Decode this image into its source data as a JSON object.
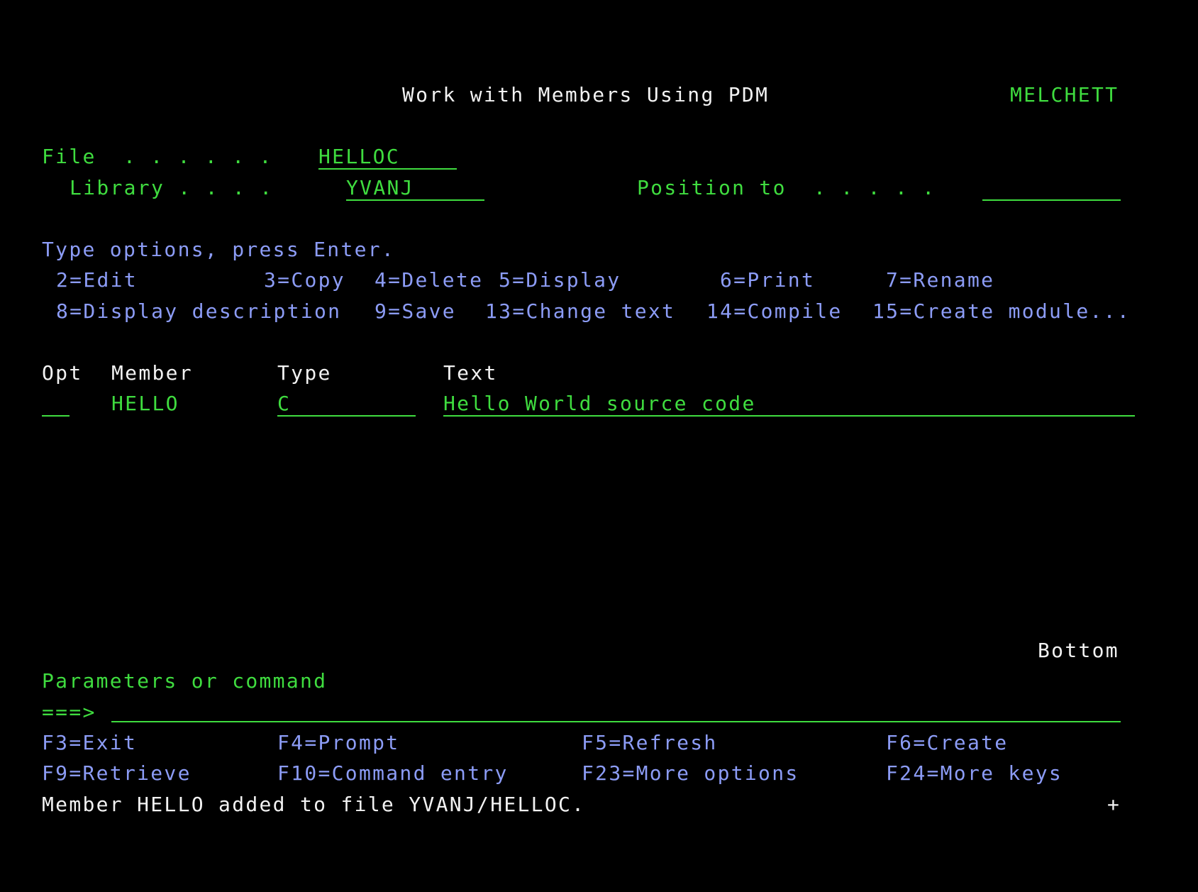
{
  "header": {
    "title": "Work with Members Using PDM",
    "system_name": "MELCHETT"
  },
  "selection": {
    "file_label": "File  . . . . . .",
    "file_value": "HELLOC",
    "library_label": "Library . . . .",
    "library_value": "YVANJ",
    "position_label": "Position to  . . . . .",
    "position_value": ""
  },
  "instructions": {
    "prompt": "Type options, press Enter.",
    "options_row1": [
      "2=Edit",
      "3=Copy",
      "4=Delete",
      "5=Display",
      "6=Print",
      "7=Rename"
    ],
    "options_row2": [
      "8=Display description",
      "9=Save",
      "13=Change text",
      "14=Compile",
      "15=Create module..."
    ]
  },
  "table": {
    "columns": [
      "Opt",
      "Member",
      "Type",
      "Text"
    ],
    "rows": [
      {
        "opt": "",
        "member": "HELLO",
        "type": "C",
        "text": "Hello World source code"
      }
    ],
    "more_indicator": "Bottom"
  },
  "command": {
    "label": "Parameters or command",
    "prompt": "===>",
    "value": ""
  },
  "function_keys": {
    "row1": [
      "F3=Exit",
      "F4=Prompt",
      "F5=Refresh",
      "F6=Create"
    ],
    "row2": [
      "F9=Retrieve",
      "F10=Command entry",
      "F23=More options",
      "F24=More keys"
    ]
  },
  "message": {
    "text": "Member HELLO added to file YVANJ/HELLOC.",
    "more_marker": "+"
  },
  "colors": {
    "background": "#000000",
    "green": "#3fdc3f",
    "white": "#f2f2f2",
    "blue": "#8c9cf6"
  }
}
